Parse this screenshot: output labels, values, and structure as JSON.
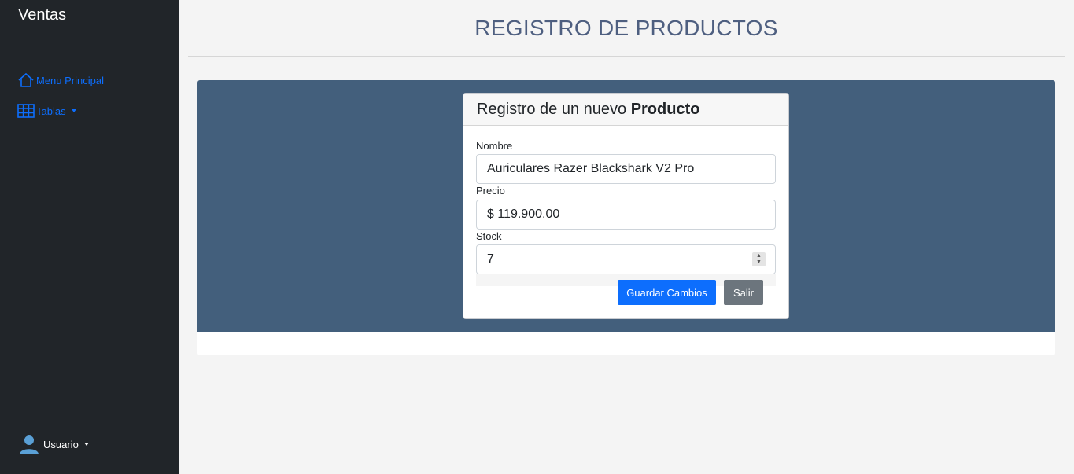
{
  "sidebar": {
    "brand": "Ventas",
    "items": [
      {
        "label": "Menu Principal",
        "icon": "home-icon"
      },
      {
        "label": "Tablas",
        "icon": "table-icon"
      }
    ],
    "user": {
      "label": "Usuario",
      "icon": "user-avatar-icon"
    }
  },
  "header": {
    "title": "REGISTRO DE PRODUCTOS"
  },
  "form": {
    "title_prefix": "Registro de un nuevo ",
    "title_bold": "Producto",
    "fields": [
      {
        "label": "Nombre",
        "value": "Auriculares Razer Blackshark V2 Pro"
      },
      {
        "label": "Precio",
        "value": "$ 119.900,00"
      },
      {
        "label": "Stock",
        "value": "7"
      }
    ],
    "buttons": {
      "save": "Guardar Cambios",
      "exit": "Salir"
    }
  },
  "colors": {
    "sidebar_bg": "#212529",
    "accent": "#0d6efd",
    "panel_band": "#435f7c",
    "title": "#4e5f80",
    "secondary_button": "#6c757d"
  }
}
